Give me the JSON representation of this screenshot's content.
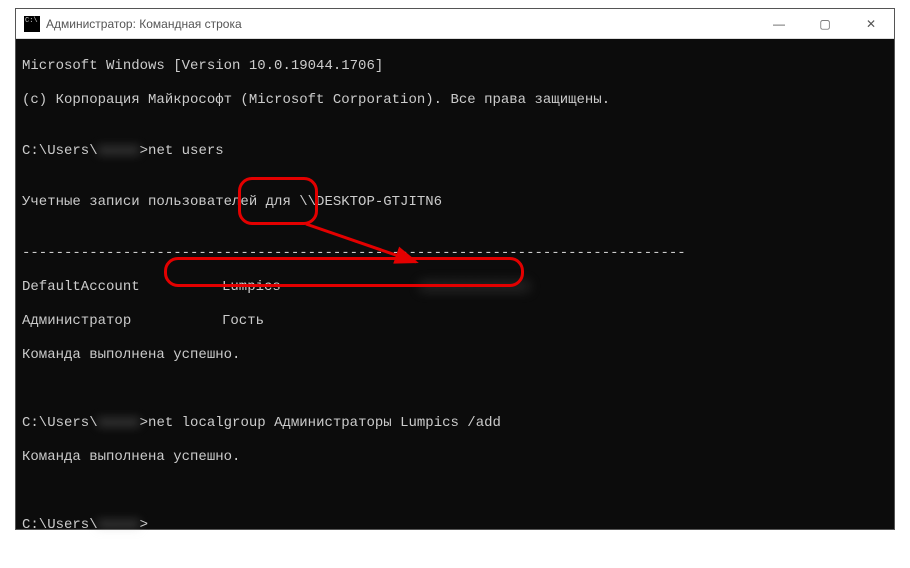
{
  "titlebar": {
    "icon": "cmd-icon",
    "title": "Администратор: Командная строка",
    "min": "—",
    "max": "▢",
    "close": "✕"
  },
  "terminal": {
    "line1": "Microsoft Windows [Version 10.0.19044.1706]",
    "line2": "(c) Корпорация Майкрософт (Microsoft Corporation). Все права защищены.",
    "blank": "",
    "prompt_prefix": "C:\\Users\\",
    "prompt_user_censored": "xxxxx",
    "prompt_gt": ">",
    "cmd1": "net users",
    "accounts_header": "Учетные записи пользователей для \\\\DESKTOP-GTJITN6",
    "separator": "-------------------------------------------------------------------------------",
    "col_a1": "DefaultAccount",
    "col_b1": "Lumpics",
    "col_c1_censored": "xxxxxxxxxxxxx",
    "col_a2": "Администратор",
    "col_b2": "Гость",
    "success": "Команда выполнена успешно.",
    "cmd2": "net localgroup Администраторы Lumpics /add"
  },
  "annotations": {
    "box1_label": "highlight-users-column",
    "box2_label": "highlight-command",
    "arrow_label": "arrow-annotation"
  }
}
